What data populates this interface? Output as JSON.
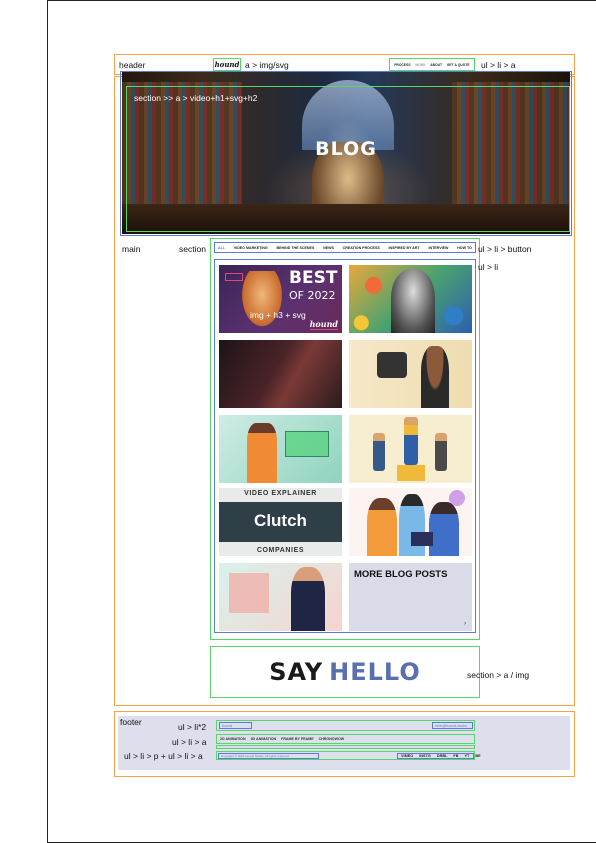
{
  "annotations": {
    "header": "header",
    "logo_link": "a > img/svg",
    "nav_list": "ul > li > a",
    "hero": "section >> a > video+h1+svg+h2",
    "main": "main",
    "section": "section",
    "filter_list": "ul > li > button",
    "grid_list": "ul > li",
    "card": "img + h3 + svg",
    "say_hello": "section > a / img",
    "footer": "footer",
    "footer_row1": "ul > li*2",
    "footer_row2": "ul > li > a",
    "footer_row3": "ul > li > p + ul > li > a"
  },
  "header": {
    "logo": "hound",
    "nav": [
      "PROCESS",
      "WORK",
      "ABOUT",
      "GET A QUOTE"
    ]
  },
  "hero": {
    "title": "BLOG"
  },
  "filters": [
    "ALL",
    "VIDEO MARKETING",
    "BEHIND THE SCENES",
    "NEWS",
    "CREATION PROCESS",
    "INSPIRED BY ART",
    "INTERVIEW",
    "HOW TO"
  ],
  "cards": {
    "best_top": "BEST",
    "best_bottom": "OF 2022",
    "best_brand": "hound",
    "clutch_top": "VIDEO EXPLAINER",
    "clutch_logo": "Clutch",
    "clutch_bottom": "COMPANIES",
    "more_title": "MORE BLOG POSTS",
    "more_arrow": "›"
  },
  "say_hello": {
    "say": "SAY",
    "hello": "HELLO"
  },
  "footer": {
    "address_left": "hound",
    "address_right": "hello@hound.studio",
    "services": [
      "2D ANIMATION",
      "3D ANIMATION",
      "FRAME BY FRAME",
      "CHRONOWOW"
    ],
    "copyright": "Copyright © 2023 Hound Studio. All rights reserved.",
    "social": [
      "VIMEO",
      "INSTG",
      "DRBL",
      "FB",
      "YT",
      "BE"
    ]
  },
  "colors": {
    "orange": "#f7a24a",
    "green": "#57d66b",
    "blue": "#5b7bd5",
    "hello": "#5a6fad"
  }
}
